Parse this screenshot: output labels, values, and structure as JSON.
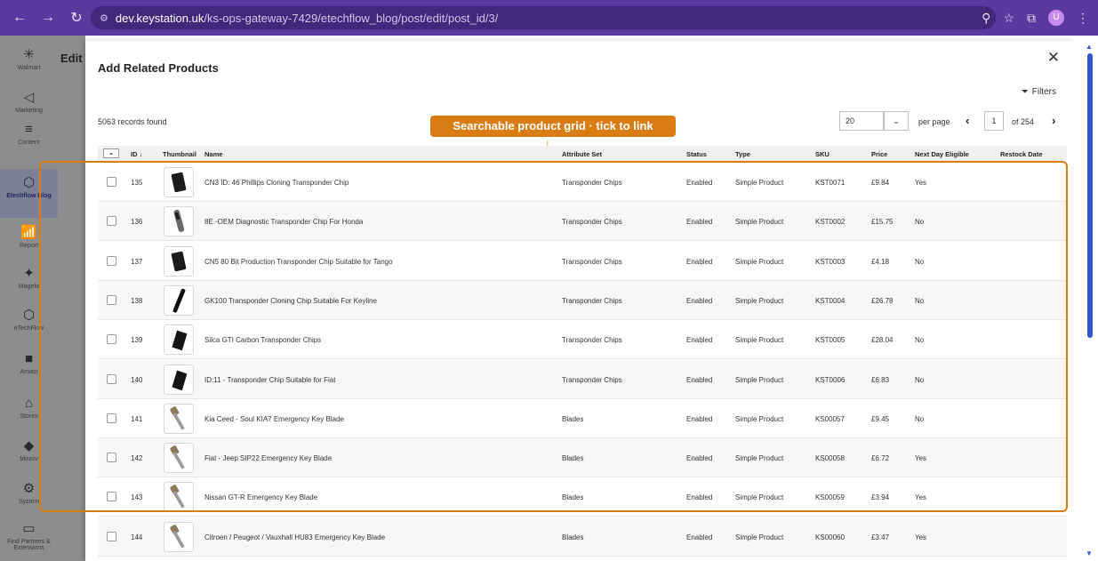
{
  "browser": {
    "url_host": "dev.keystation.uk",
    "url_path": "/ks-ops-gateway-7429/etechflow_blog/post/edit/post_id/3/",
    "avatar_letter": "U"
  },
  "sidebar": {
    "items": [
      {
        "label": "Walmart",
        "icon": "walmart-spark-icon"
      },
      {
        "label": "Marketing",
        "icon": "megaphone-icon"
      },
      {
        "label": "Content",
        "icon": "content-icon"
      },
      {
        "label": "Etechflow Blog",
        "icon": "cube-icon"
      },
      {
        "label": "Report",
        "icon": "report-chart-icon"
      },
      {
        "label": "Magefa",
        "icon": "magefan-icon"
      },
      {
        "label": "eTechFlow",
        "icon": "cube-outline-icon"
      },
      {
        "label": "Amast",
        "icon": "amasty-icon"
      },
      {
        "label": "Stores",
        "icon": "store-icon"
      },
      {
        "label": "Mirasv",
        "icon": "mirasvit-icon"
      },
      {
        "label": "System",
        "icon": "gear-icon"
      },
      {
        "label": "Find Partners & Extensions",
        "icon": "partners-icon"
      }
    ],
    "edit_heading": "Edit"
  },
  "modal": {
    "title": "Add Related Products",
    "filters_label": "Filters",
    "records_found": "5063 records found",
    "page_size": "20",
    "per_page_label": "per page",
    "current_page": "1",
    "total_pages_label": "of 254",
    "callout": "Searchable product grid · tick to link"
  },
  "table": {
    "headers": {
      "id": "ID",
      "thumbnail": "Thumbnail",
      "name": "Name",
      "attribute_set": "Attribute Set",
      "status": "Status",
      "type": "Type",
      "sku": "SKU",
      "price": "Price",
      "next_day": "Next Day Eligible",
      "restock": "Restock Date"
    },
    "rows": [
      {
        "id": "135",
        "name": "CN3 ID: 46 Phillips Cloning Transponder Chip",
        "attribute_set": "Transponder Chips",
        "status": "Enabled",
        "type": "Simple Product",
        "sku": "KST0071",
        "price": "£9.84",
        "next_day": "Yes",
        "thumb": "chip"
      },
      {
        "id": "136",
        "name": "8E -OEM Diagnostic Transponder Chip For Honda",
        "attribute_set": "Transponder Chips",
        "status": "Enabled",
        "type": "Simple Product",
        "sku": "KST0002",
        "price": "£15.75",
        "next_day": "No",
        "thumb": "glass"
      },
      {
        "id": "137",
        "name": "CN5 80 Bit Production Transponder Chip Suitable for Tango",
        "attribute_set": "Transponder Chips",
        "status": "Enabled",
        "type": "Simple Product",
        "sku": "KST0003",
        "price": "£4.18",
        "next_day": "No",
        "thumb": "chip"
      },
      {
        "id": "138",
        "name": "GK100 Transponder Cloning Chip Suitable For Keyline",
        "attribute_set": "Transponder Chips",
        "status": "Enabled",
        "type": "Simple Product",
        "sku": "KST0004",
        "price": "£26.78",
        "next_day": "No",
        "thumb": "rod"
      },
      {
        "id": "139",
        "name": "Silca GTI Carbon Transponder Chips",
        "attribute_set": "Transponder Chips",
        "status": "Enabled",
        "type": "Simple Product",
        "sku": "KST0005",
        "price": "£28.04",
        "next_day": "No",
        "thumb": "wedge"
      },
      {
        "id": "140",
        "name": "ID:11 - Transponder Chip Suitable for Fiat",
        "attribute_set": "Transponder Chips",
        "status": "Enabled",
        "type": "Simple Product",
        "sku": "KST0006",
        "price": "£6.83",
        "next_day": "No",
        "thumb": "wedge"
      },
      {
        "id": "141",
        "name": "Kia Ceed - Soul KIA7 Emergency Key Blade",
        "attribute_set": "Blades",
        "status": "Enabled",
        "type": "Simple Product",
        "sku": "KS00057",
        "price": "£9.45",
        "next_day": "No",
        "thumb": "blade"
      },
      {
        "id": "142",
        "name": "Fiat - Jeep SIP22 Emergency Key Blade",
        "attribute_set": "Blades",
        "status": "Enabled",
        "type": "Simple Product",
        "sku": "KS00058",
        "price": "£6.72",
        "next_day": "Yes",
        "thumb": "blade"
      },
      {
        "id": "143",
        "name": "Nissan GT-R Emergency Key Blade",
        "attribute_set": "Blades",
        "status": "Enabled",
        "type": "Simple Product",
        "sku": "KS00059",
        "price": "£3.94",
        "next_day": "Yes",
        "thumb": "blade"
      },
      {
        "id": "144",
        "name": "Citroen / Peugeot / Vauxhall HU83 Emergency Key Blade",
        "attribute_set": "Blades",
        "status": "Enabled",
        "type": "Simple Product",
        "sku": "KS00060",
        "price": "£3.47",
        "next_day": "Yes",
        "thumb": "blade"
      }
    ]
  },
  "colors": {
    "browser_bar": "#5b3aa0",
    "callout": "#d97d12",
    "scrollbar": "#2f57d0"
  }
}
